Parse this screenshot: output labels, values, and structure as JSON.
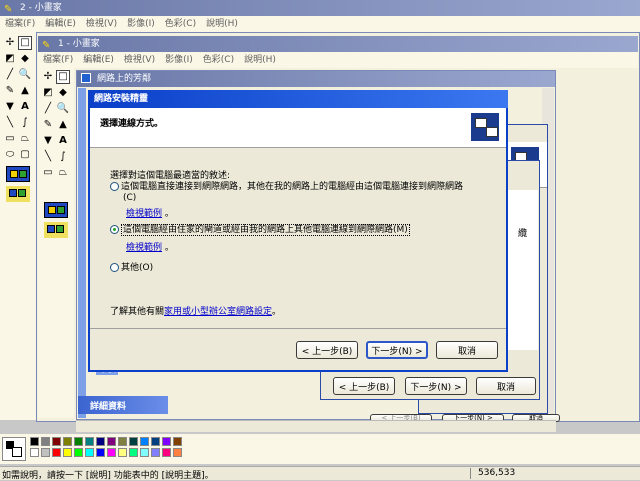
{
  "outer_app": {
    "title": "2 - 小畫家",
    "menu": [
      "檔案(F)",
      "編輯(E)",
      "檢視(V)",
      "影像(I)",
      "色彩(C)",
      "說明(H)"
    ]
  },
  "inner_app": {
    "title": "1 - 小畫家",
    "menu": [
      "檔案(F)",
      "編輯(E)",
      "檢視(V)",
      "影像(I)",
      "色彩(C)",
      "說明(H)"
    ]
  },
  "network_places": {
    "title": "網路上的芳鄰",
    "details_label": "詳細資料",
    "printer_label": "印表"
  },
  "back_wizard": {
    "side_char": "纜",
    "back_label": "< 上一步(B)",
    "next_label": "下一步(N) >",
    "cancel_label": "取消",
    "back2_label": "< 上一步(B)",
    "next2_label": "下一步(N) >",
    "cancel2_label": "取消"
  },
  "wizard": {
    "title": "網路安裝精靈",
    "heading": "選擇連線方式。",
    "instruction": "選擇對這個電腦最適當的敘述:",
    "option1": "這個電腦直接連接到網際網路，其他在我的網路上的電腦經由這個電腦連接到網際網路",
    "option1_line2": "(C)",
    "example_link1": "檢視範例",
    "option2": "這個電腦經由住家的閘道或經由我的網路上其他電腦連線到網際網路(M)",
    "example_link2": "檢視範例",
    "option3": "其他(O)",
    "learn_prefix": "了解其他有關",
    "learn_link": "家用或小型辦公室網路設定",
    "learn_suffix": "。",
    "back_label": "< 上一步(B)",
    "next_label": "下一步(N) >",
    "cancel_label": "取消"
  },
  "status": {
    "help_text": "如需說明，請按一下 [說明] 功能表中的 [說明主題]。",
    "coords": "536,533"
  },
  "palette": {
    "primary": "#000000",
    "secondary": "#ffffff",
    "colors": [
      "#000000",
      "#808080",
      "#800000",
      "#808000",
      "#008000",
      "#008080",
      "#000080",
      "#800080",
      "#808040",
      "#004040",
      "#0080ff",
      "#004080",
      "#8000ff",
      "#804000",
      "#ffffff",
      "#c0c0c0",
      "#ff0000",
      "#ffff00",
      "#00ff00",
      "#00ffff",
      "#0000ff",
      "#ff00ff",
      "#ffff80",
      "#00ff80",
      "#80ffff",
      "#8080ff",
      "#ff0080",
      "#ff8040"
    ]
  }
}
